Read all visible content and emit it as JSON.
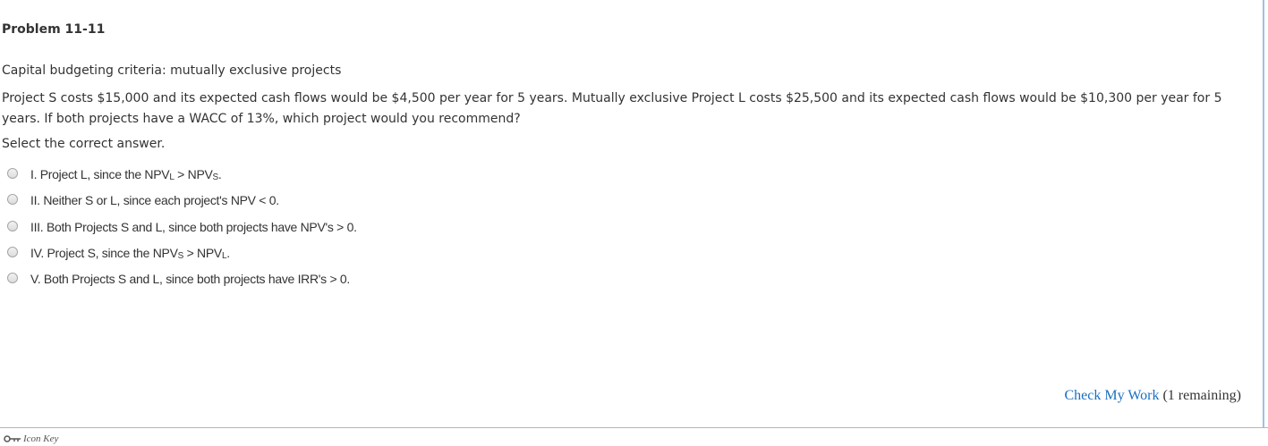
{
  "problem": {
    "title": "Problem 11-11",
    "subtitle": "Capital budgeting criteria: mutually exclusive projects",
    "question": "Project S costs $15,000 and its expected cash flows would be $4,500 per year for 5 years. Mutually exclusive Project L costs $25,500 and its expected cash flows would be $10,300 per year for 5 years. If both projects have a WACC of 13%, which project would you recommend?",
    "instruction": "Select the correct answer."
  },
  "options": [
    {
      "text": "I. Project L, since the NPV",
      "sub1": "L",
      "text2": " > NPV",
      "sub2": "S",
      "text3": "."
    },
    {
      "text": "II. Neither S or L, since each project's NPV < 0.",
      "sub1": "",
      "text2": "",
      "sub2": "",
      "text3": ""
    },
    {
      "text": "III. Both Projects S and L, since both projects have NPV's > 0.",
      "sub1": "",
      "text2": "",
      "sub2": "",
      "text3": ""
    },
    {
      "text": "IV. Project S, since the NPV",
      "sub1": "S",
      "text2": " > NPV",
      "sub2": "L",
      "text3": "."
    },
    {
      "text": "V. Both Projects S and L, since both projects have IRR's > 0.",
      "sub1": "",
      "text2": "",
      "sub2": "",
      "text3": ""
    }
  ],
  "footer": {
    "check_link": "Check My Work",
    "remaining": " (1 remaining)",
    "icon_key_label": "Icon Key"
  },
  "icons": {
    "radio": "radio-button-icon",
    "key": "key-icon"
  },
  "colors": {
    "link": "#1a6fc0",
    "text": "#333333",
    "right_rule": "#9ec1e8"
  }
}
